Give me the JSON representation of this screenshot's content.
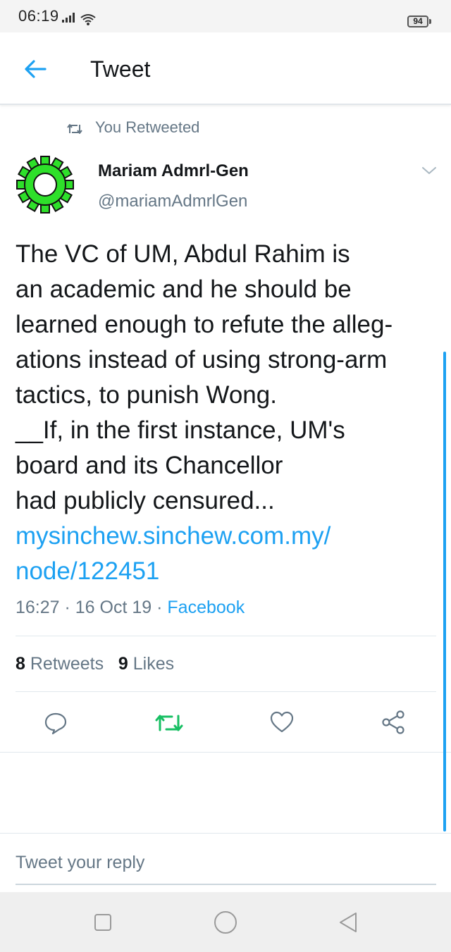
{
  "status_bar": {
    "time": "06:19",
    "battery": "94",
    "icons": [
      "signal-icon",
      "wifi-icon",
      "battery-icon"
    ]
  },
  "header": {
    "title": "Tweet",
    "back_icon": "arrow-left-icon"
  },
  "retweet_context": {
    "label": "You Retweeted"
  },
  "author": {
    "name": "Mariam Admrl-Gen",
    "handle": "@mariamAdmrlGen",
    "avatar_color": "#3ee03b"
  },
  "tweet": {
    "text": "The VC of UM, Abdul Rahim is\nan academic and he should be\nlearned enough to refute the alleg-\nations instead of using strong-arm\ntactics, to punish Wong.\n__If, in the first instance, UM's\nboard and its Chancellor\nhad publicly censured...",
    "link": "mysinchew.sinchew.com.my/\nnode/122451",
    "timestamp": "16:27 · 16 Oct 19 · ",
    "source": "Facebook"
  },
  "stats": {
    "retweets_count": "8",
    "retweets_label": "Retweets",
    "likes_count": "9",
    "likes_label": "Likes"
  },
  "actions": {
    "icons": [
      "reply-icon",
      "retweet-icon",
      "like-icon",
      "share-icon"
    ],
    "retweet_active_color": "#17bf63"
  },
  "reply": {
    "placeholder": "Tweet your reply"
  },
  "colors": {
    "accent": "#1da1f2",
    "secondary_text": "#657786",
    "primary_text": "#14171a"
  }
}
